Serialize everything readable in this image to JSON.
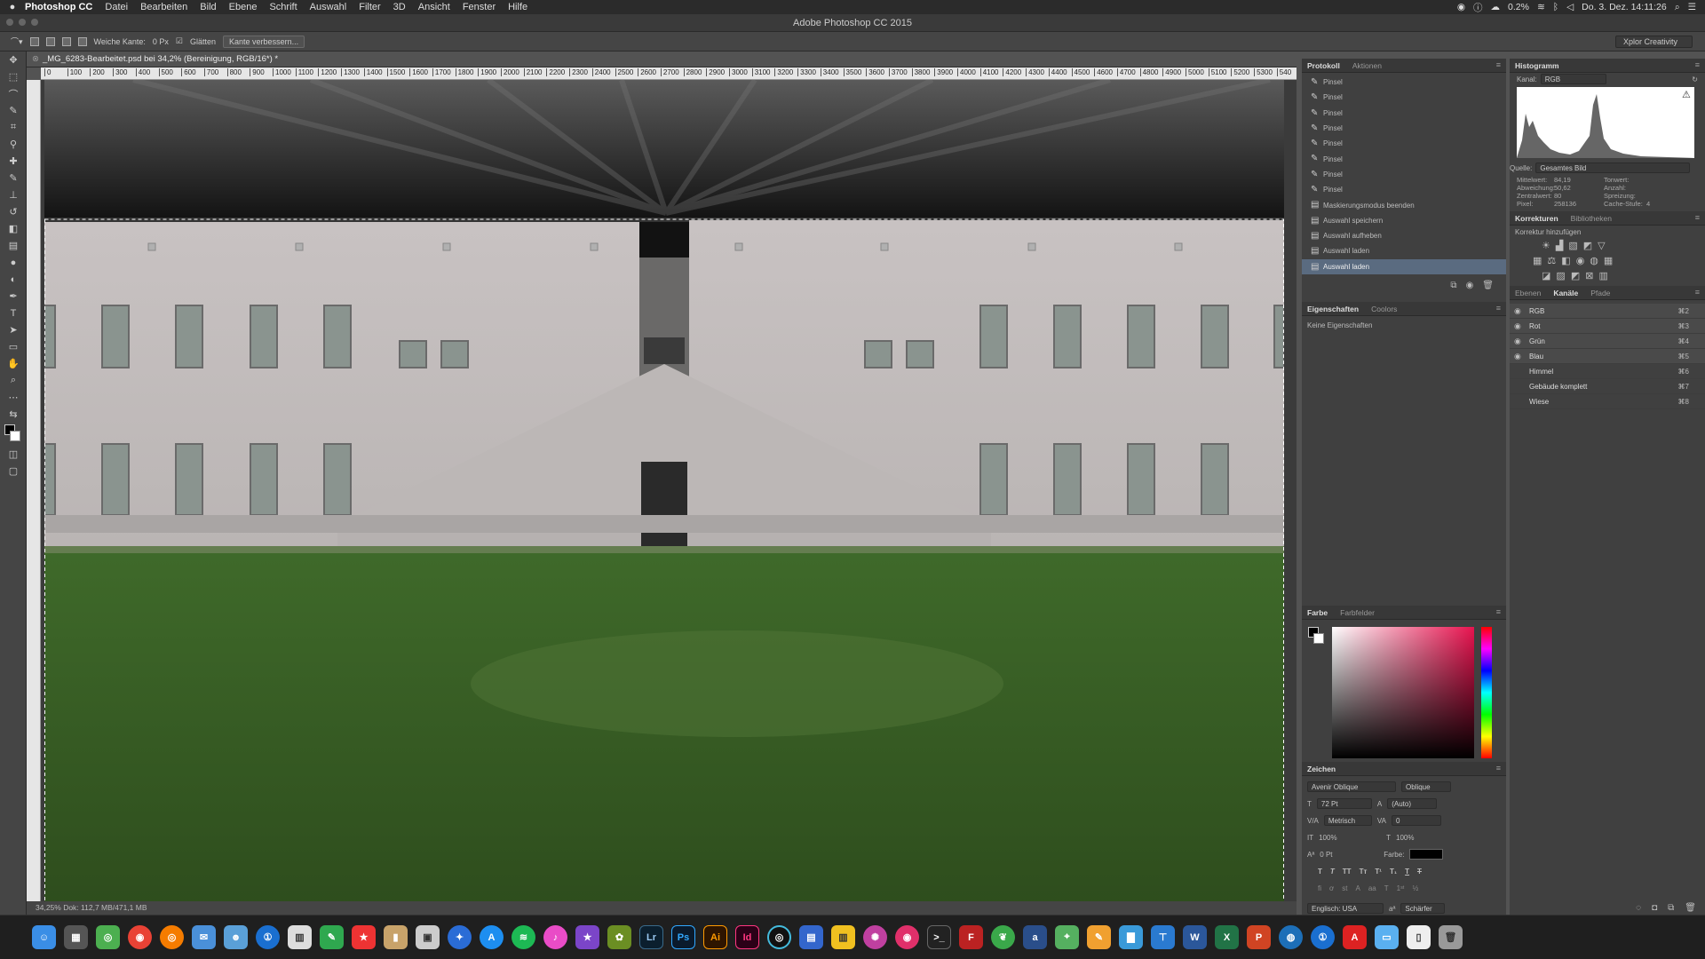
{
  "menubar": {
    "apple": "",
    "app": "Photoshop CC",
    "items": [
      "Datei",
      "Bearbeiten",
      "Bild",
      "Ebene",
      "Schrift",
      "Auswahl",
      "Filter",
      "3D",
      "Ansicht",
      "Fenster",
      "Hilfe"
    ],
    "cpu": "0.2%",
    "clock": "Do. 3. Dez. 14:11:26"
  },
  "window": {
    "title": "Adobe Photoshop CC 2015"
  },
  "options": {
    "feather_label": "Weiche Kante:",
    "feather_value": "0 Px",
    "smooth_label": "Glätten",
    "refine_button": "Kante verbessern...",
    "workspace": "Xplor Creativity"
  },
  "document": {
    "tab_title": "_MG_6283-Bearbeitet.psd bei 34,2% (Bereinigung, RGB/16*) *",
    "status": "34,25%    Dok: 112,7 MB/471,1 MB"
  },
  "ruler": {
    "ticks": [
      "0",
      "100",
      "200",
      "300",
      "400",
      "500",
      "600",
      "700",
      "800",
      "900",
      "1000",
      "1100",
      "1200",
      "1300",
      "1400",
      "1500",
      "1600",
      "1700",
      "1800",
      "1900",
      "2000",
      "2100",
      "2200",
      "2300",
      "2400",
      "2500",
      "2600",
      "2700",
      "2800",
      "2900",
      "3000",
      "3100",
      "3200",
      "3300",
      "3400",
      "3500",
      "3600",
      "3700",
      "3800",
      "3900",
      "4000",
      "4100",
      "4200",
      "4300",
      "4400",
      "4500",
      "4600",
      "4700",
      "4800",
      "4900",
      "5000",
      "5100",
      "5200",
      "5300",
      "540"
    ]
  },
  "history": {
    "tab_active": "Protokoll",
    "tab_other": "Aktionen",
    "items": [
      "Pinsel",
      "Pinsel",
      "Pinsel",
      "Pinsel",
      "Pinsel",
      "Pinsel",
      "Pinsel",
      "Pinsel",
      "Maskierungsmodus beenden",
      "Auswahl speichern",
      "Auswahl aufheben",
      "Auswahl laden",
      "Auswahl laden"
    ],
    "selected_index": 12
  },
  "properties": {
    "tab_active": "Eigenschaften",
    "tab_other": "Coolors",
    "empty_text": "Keine Eigenschaften"
  },
  "color": {
    "tab_active": "Farbe",
    "tab_other": "Farbfelder",
    "hue_color": "#e8134f"
  },
  "character": {
    "tab": "Zeichen",
    "font": "Avenir Oblique",
    "style": "Oblique",
    "size": "72 Pt",
    "leading": "(Auto)",
    "kerning": "Metrisch",
    "tracking": "0",
    "vscale": "100%",
    "hscale": "100%",
    "baseline": "0 Pt",
    "color_label": "Farbe:",
    "language": "Englisch: USA",
    "aa": "Schärfer"
  },
  "histogram": {
    "tab": "Histogramm",
    "channel_label": "Kanal:",
    "channel": "RGB",
    "source_label": "Quelle:",
    "source": "Gesamtes Bild",
    "stats": [
      [
        "Mittelwert:",
        "84,19",
        "Tonwert:",
        ""
      ],
      [
        "Abweichung:",
        "50,62",
        "Anzahl:",
        ""
      ],
      [
        "Zentralwert:",
        "80",
        "Spreizung:",
        ""
      ],
      [
        "Pixel:",
        "258136",
        "Cache-Stufe:",
        "4"
      ]
    ]
  },
  "adjustments": {
    "tab_active": "Korrekturen",
    "tab_other": "Bibliotheken",
    "hint": "Korrektur hinzufügen"
  },
  "channels": {
    "tabs": [
      "Ebenen",
      "Kanäle",
      "Pfade"
    ],
    "active_tab": "Kanäle",
    "rows": [
      {
        "name": "RGB",
        "key": "⌘2"
      },
      {
        "name": "Rot",
        "key": "⌘3"
      },
      {
        "name": "Grün",
        "key": "⌘4"
      },
      {
        "name": "Blau",
        "key": "⌘5"
      }
    ],
    "alpha_rows": [
      {
        "name": "Himmel",
        "key": "⌘6"
      },
      {
        "name": "Gebäude komplett",
        "key": "⌘7"
      },
      {
        "name": "Wiese",
        "key": "⌘8"
      }
    ]
  },
  "dock": {
    "apps": [
      "Lr",
      "Ps",
      "Ai",
      "Id"
    ]
  }
}
